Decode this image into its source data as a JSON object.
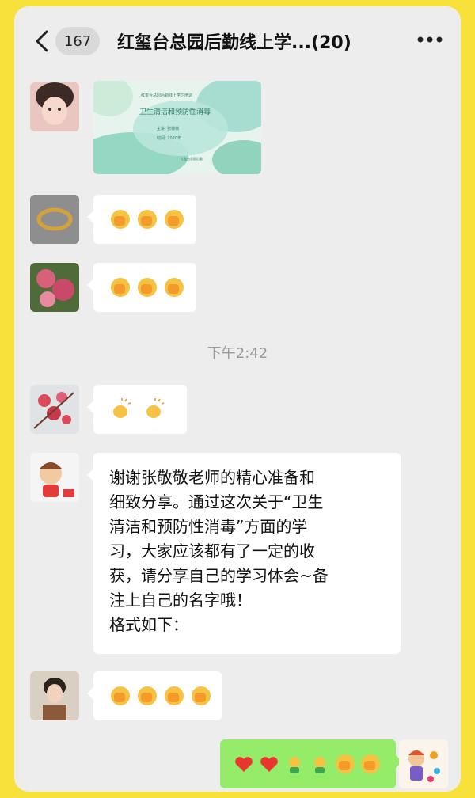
{
  "header": {
    "unread_count": "167",
    "title": "红玺台总园后勤线上学...(20)"
  },
  "image_card": {
    "top_text": "红玺台总园后勤线上学习培训",
    "headline": "卫生清洁和预防性消毒",
    "line1": "主讲: 张敬敬",
    "line2": "时间: 2020年",
    "footer": "红玺台总园后勤"
  },
  "timestamp": "下午2:42",
  "long_message": "谢谢张敬敬老师的精心准备和\n细致分享。通过这次关于“卫生\n清洁和预防性消毒”方面的学\n习，大家应该都有了一定的收\n获，请分享自己的学习体会~备\n注上自己的名字哦！\n格式如下：",
  "colors": {
    "accent_green": "#95ec69",
    "frame_yellow": "#f7e13a"
  },
  "icons": [
    "back-arrow-icon",
    "more-dots-icon",
    "clap-icon",
    "heart-icon",
    "sprout-icon",
    "fist-icon"
  ]
}
